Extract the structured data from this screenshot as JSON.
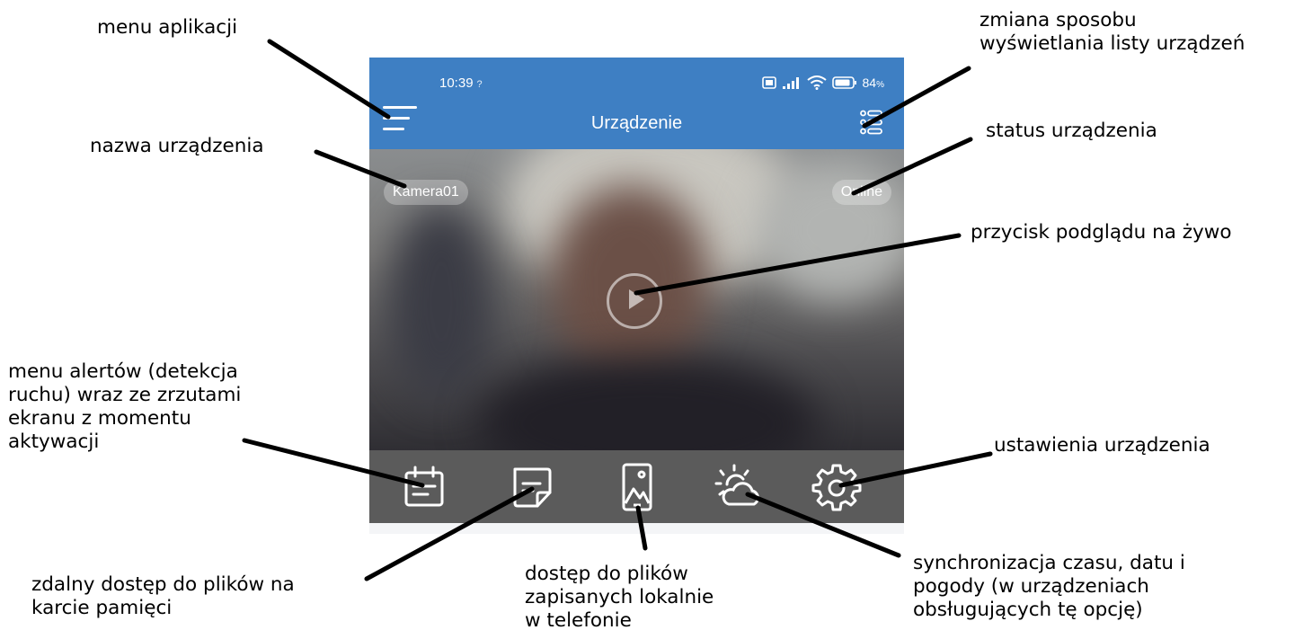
{
  "phone": {
    "status_bar": {
      "time": "10:39",
      "battery": "84",
      "battery_unit": "%"
    },
    "app_bar": {
      "title": "Urządzenie",
      "menu_icon": "hamburger-icon",
      "view_icon": "list-view-icon"
    },
    "device": {
      "name": "Kamera01",
      "status": "Online"
    },
    "toolbar": {
      "icons": [
        "calendar-icon",
        "note-icon",
        "phone-gallery-icon",
        "weather-icon",
        "gear-icon"
      ]
    }
  },
  "annotations": {
    "menu": "menu aplikacji",
    "view_mode": [
      "zmiana sposobu",
      "wyświetlania listy urządzeń"
    ],
    "device_name": "nazwa urządzenia",
    "device_status": "status urządzenia",
    "live_view": "przycisk podglądu na żywo",
    "alerts": [
      "menu alertów (detekcja",
      "ruchu) wraz ze zrzutami",
      "ekranu z momentu",
      "aktywacji"
    ],
    "settings": "ustawienia urządzenia",
    "remote_files": [
      "zdalny dostęp do plików na",
      "karcie pamięci"
    ],
    "local_files": [
      "dostęp do plików",
      "zapisanych lokalnie",
      "w telefonie"
    ],
    "sync": [
      "synchronizacja czasu, datu i",
      "pogody (w urządzeniach",
      "obsługujących tę opcję)"
    ]
  },
  "colors": {
    "app_bar": "#3e7fc3",
    "toolbar": "#5b5b5b",
    "leader_lines": "#000000"
  }
}
